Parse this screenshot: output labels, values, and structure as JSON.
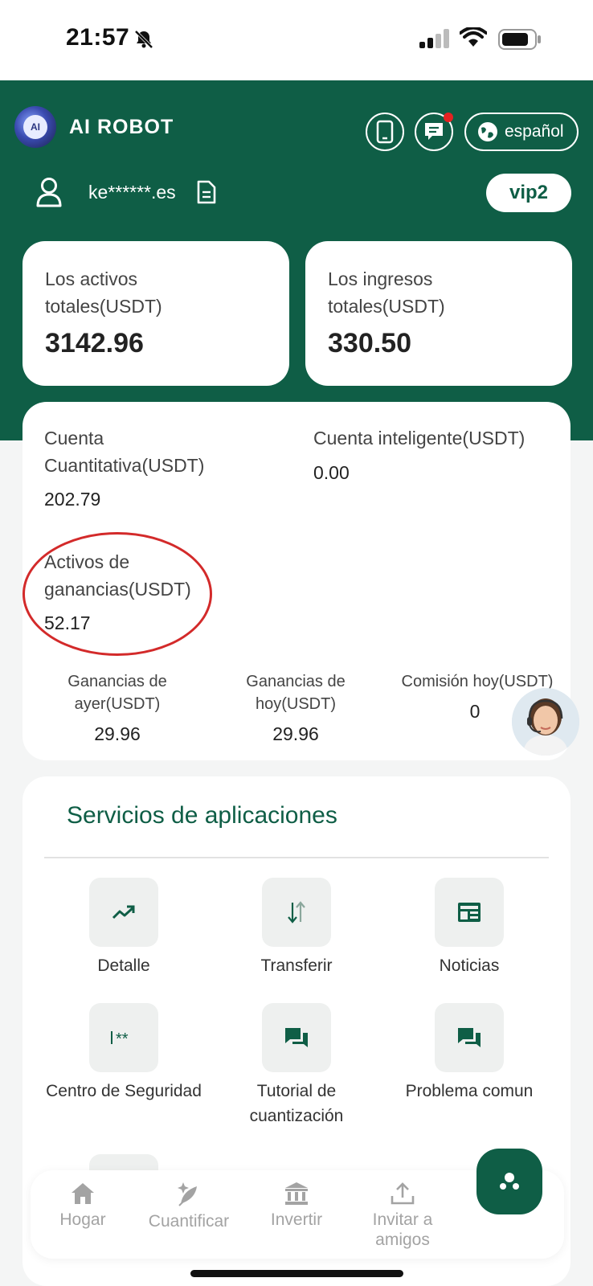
{
  "status_bar": {
    "time": "21:57"
  },
  "header": {
    "logo_text": "AI",
    "app_title": "AI ROBOT",
    "language": "español",
    "username": "ke******.es",
    "vip_level": "vip2"
  },
  "stats": {
    "total_assets": {
      "label": "Los activos totales(USDT)",
      "value": "3142.96"
    },
    "total_income": {
      "label": "Los ingresos totales(USDT)",
      "value": "330.50"
    }
  },
  "accounts": {
    "quant": {
      "label": "Cuenta Cuantitativa(USDT)",
      "value": "202.79"
    },
    "smart": {
      "label": "Cuenta inteligente(USDT)",
      "value": "0.00"
    },
    "earnings_assets": {
      "label": "Activos de ganancias(USDT)",
      "value": "52.17"
    },
    "yesterday": {
      "label": "Ganancias de ayer(USDT)",
      "value": "29.96"
    },
    "today": {
      "label": "Ganancias de hoy(USDT)",
      "value": "29.96"
    },
    "commission": {
      "label": "Comisión hoy(USDT)",
      "value": "0"
    }
  },
  "services": {
    "title": "Servicios de aplicaciones",
    "items": [
      {
        "label": "Detalle",
        "icon": "trending-up-icon"
      },
      {
        "label": "Transferir",
        "icon": "swap-vertical-icon"
      },
      {
        "label": "Noticias",
        "icon": "newspaper-icon"
      },
      {
        "label": "Centro de Seguridad",
        "icon": "password-icon"
      },
      {
        "label": "Tutorial de cuantización",
        "icon": "chat-icon"
      },
      {
        "label": "Problema comun",
        "icon": "chat-icon"
      }
    ]
  },
  "bottom_nav": {
    "items": [
      {
        "label": "Hogar",
        "icon": "home-icon"
      },
      {
        "label": "Cuantificar",
        "icon": "feather-icon"
      },
      {
        "label": "Invertir",
        "icon": "bank-icon"
      },
      {
        "label": "Invitar a amigos",
        "icon": "share-upload-icon"
      }
    ]
  },
  "colors": {
    "brand_green": "#0f5e46",
    "annotation_red": "#d32a2a",
    "notification_dot": "#e52222"
  }
}
